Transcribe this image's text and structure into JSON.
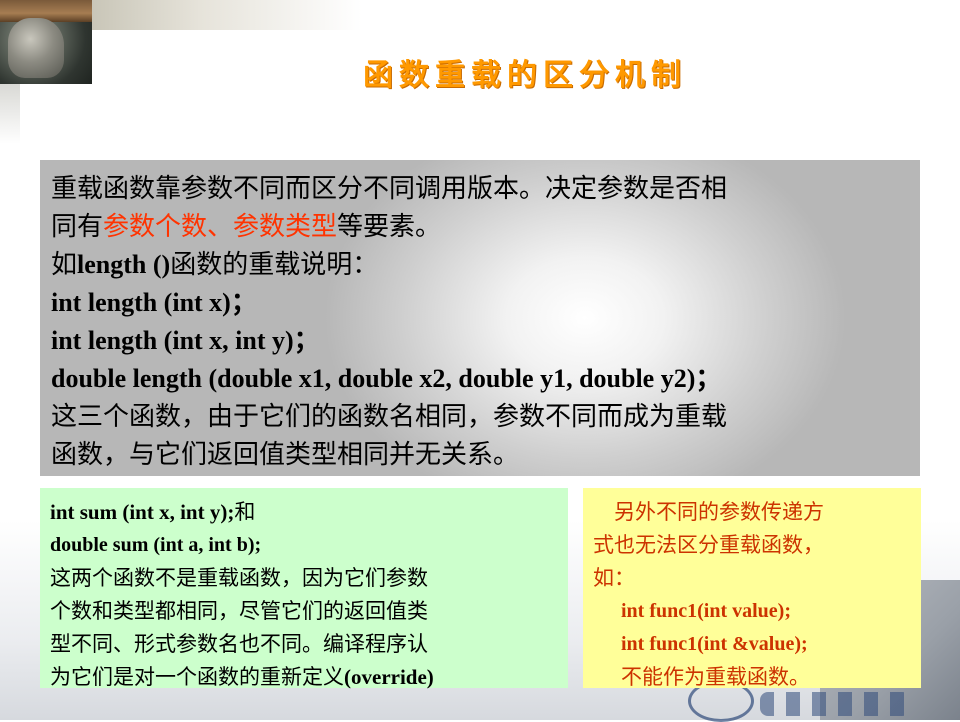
{
  "slide": {
    "title": "函数重载的区分机制"
  },
  "main_box": {
    "line1": "重载函数靠参数不同而区分不同调用版本。决定参数是否相",
    "line2_prefix": "同有",
    "line2_highlight": "参数个数、参数类型",
    "line2_suffix": "等要素。",
    "line3_prefix": "如",
    "line3_code": "length ()",
    "line3_suffix": "函数的重载说明：",
    "code1": "int length (int x)；",
    "code2": "int length (int x, int y)；",
    "code3": "double length (double x1, double x2, double y1, double y2)；",
    "line7": "这三个函数，由于它们的函数名相同，参数不同而成为重载",
    "line8": "函数，与它们返回值类型相同并无关系。"
  },
  "green_box": {
    "code1_en": "int sum (int x, int y);",
    "code1_cn": "和",
    "code2": "double sum (int a, int b);",
    "line3": "这两个函数不是重载函数，因为它们参数",
    "line4": "个数和类型都相同，尽管它们的返回值类",
    "line5": "型不同、形式参数名也不同。编译程序认",
    "line6_prefix": "为它们是对一个函数的重新定义",
    "line6_code": "(override)"
  },
  "yellow_box": {
    "line1": "　另外不同的参数传递方",
    "line2": "式也无法区分重载函数，",
    "line3": "如：",
    "code1": "int func1(int value);",
    "code2": "int func1(int &value);",
    "line6": "不能作为重载函数。"
  },
  "colors": {
    "title": "#ff9900",
    "highlight": "#ff3300",
    "green_box_bg": "#ccffcc",
    "yellow_box_bg": "#ffff99",
    "yellow_text": "#cc3300"
  }
}
